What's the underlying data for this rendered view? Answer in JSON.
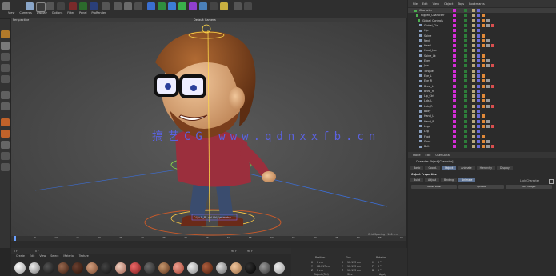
{
  "menubar": [
    "File",
    "Edit",
    "Create",
    "Select",
    "Tools",
    "Mesh",
    "Snap",
    "Animate",
    "Simulate",
    "Tracker",
    "Render",
    "Sculpt",
    "Motion Tracker",
    "MoGraph",
    "Character",
    "Pipeline",
    "Plugins",
    "Script",
    "Window",
    "Help"
  ],
  "viewport": {
    "label": "Perspective",
    "menu": [
      "View",
      "Cameras",
      "Display",
      "Options",
      "Filter",
      "Panel",
      "ProRender"
    ],
    "camera": "Default Camera",
    "grid": "Grid Spacing : 100 cm",
    "watermark": "搞艺CG www.qdnxxfb.cn",
    "ground_label": "C:\\Ls.B_BL.col.Ch\\Symmetry"
  },
  "timeline": {
    "ticks": [
      "0",
      "5",
      "10",
      "15",
      "20",
      "25",
      "30",
      "35",
      "40",
      "45",
      "50",
      "55",
      "60",
      "65",
      "70",
      "75",
      "80",
      "85",
      "90"
    ],
    "frame_start": "0 F",
    "frame_cur": "0 F",
    "frame_end": "90 F",
    "frame_end2": "90 F"
  },
  "material_bar": {
    "menu": [
      "Create",
      "Edit",
      "View",
      "Select",
      "Material",
      "Texture"
    ]
  },
  "coords": {
    "headers": [
      "Position",
      "Size",
      "Rotation"
    ],
    "rows": [
      [
        "X",
        "0 cm",
        "X",
        "10.193 cm",
        "H",
        "0 °"
      ],
      [
        "Y",
        "68.017 cm",
        "Y",
        "10.193 cm",
        "P",
        "0 °"
      ],
      [
        "Z",
        "0 cm",
        "Z",
        "10.193 cm",
        "B",
        "0 °"
      ]
    ],
    "buttons": [
      "Object (Rel)",
      "Size",
      "Apply"
    ]
  },
  "object_manager": {
    "menu": [
      "File",
      "Edit",
      "View",
      "Object",
      "Tags",
      "Bookmarks"
    ],
    "objects": [
      "Character",
      "Rigged_Character",
      "Global_Controls",
      "Global_Ctrl",
      "Hip",
      "Spine",
      "Neck",
      "Head",
      "Head_Loc",
      "Spine_Lk",
      "Eyes",
      "Jaw",
      "Tongue",
      "Eye_L",
      "Eye_R",
      "Brow_L",
      "Brow_R",
      "Lip_Ctrl",
      "Lids_L",
      "Lids_R",
      "Body",
      "Hand_L",
      "Hand_R",
      "Legs",
      "Leg",
      "Foot",
      "Shoe",
      "Belt"
    ]
  },
  "attr_manager": {
    "menu": [
      "Mode",
      "Edit",
      "User Data"
    ],
    "object_label": "Character Object [Character]",
    "tabs": [
      "Basic",
      "Coord.",
      "Object",
      "Animate",
      "Hierarchy",
      "Display"
    ],
    "active_tab": "Object",
    "section": "Object Properties",
    "subtabs": [
      "Build",
      "Adjust",
      "Binding",
      "Animate"
    ],
    "active_subtab": "Animate",
    "lock": "Lock Character",
    "buttons": [
      "Reset Pose",
      "Update",
      "Add Weight"
    ]
  }
}
